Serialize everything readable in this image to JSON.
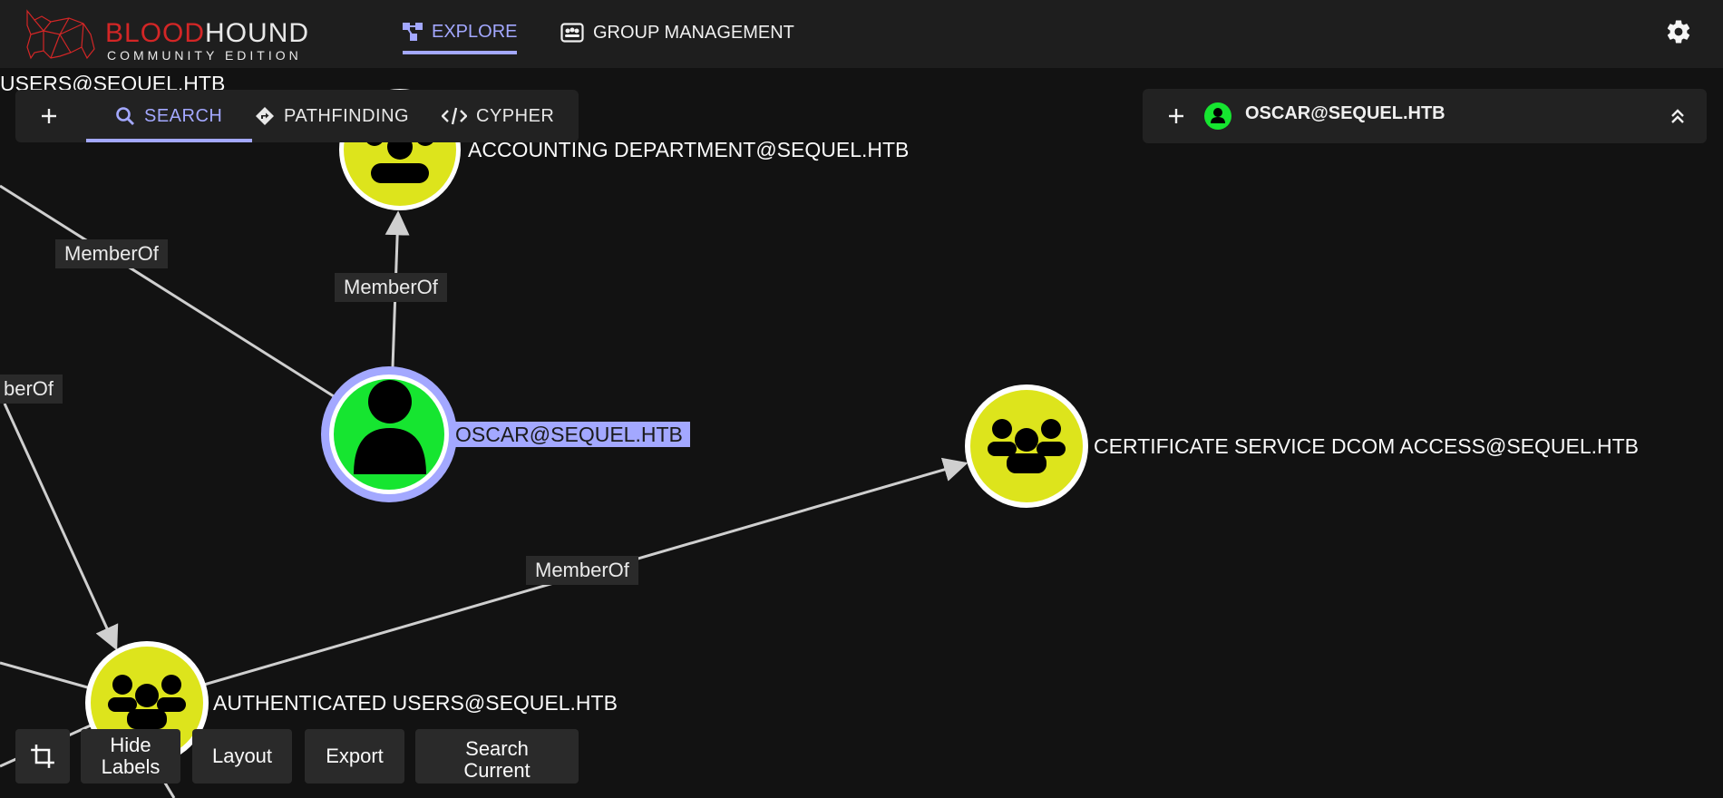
{
  "brand": {
    "part1_red": "BLOOD",
    "part1_rest": "HOUND",
    "part2": "COMMUNITY EDITION"
  },
  "nav": {
    "explore": "EXPLORE",
    "group_management": "GROUP MANAGEMENT"
  },
  "search_panel": {
    "search": "SEARCH",
    "pathfinding": "PATHFINDING",
    "cypher": "CYPHER"
  },
  "entity_panel": {
    "name": "OSCAR@SEQUEL.HTB"
  },
  "graph": {
    "nodes": {
      "users_top": "USERS@SEQUEL.HTB",
      "accounting": "ACCOUNTING DEPARTMENT@SEQUEL.HTB",
      "oscar": "OSCAR@SEQUEL.HTB",
      "cert_dcom": "CERTIFICATE SERVICE DCOM ACCESS@SEQUEL.HTB",
      "auth_users": "AUTHENTICATED USERS@SEQUEL.HTB"
    },
    "edges": {
      "e1": "MemberOf",
      "e2": "MemberOf",
      "e3": "berOf",
      "e4": "MemberOf"
    }
  },
  "toolbar": {
    "hide_labels": "Hide Labels",
    "layout": "Layout",
    "export": "Export",
    "search_current": "Search Current Results"
  },
  "colors": {
    "accent": "#a3a8ff",
    "group_node": "#dde41c",
    "user_node": "#16e530",
    "brand_red": "#d32626"
  }
}
